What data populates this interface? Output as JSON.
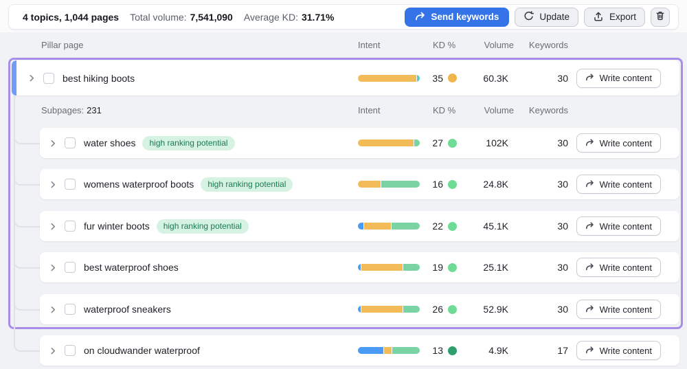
{
  "topbar": {
    "summary": {
      "topics_pages": "4 topics, 1,044 pages",
      "total_volume_label": "Total volume:",
      "total_volume_value": "7,541,090",
      "average_kd_label": "Average KD:",
      "average_kd_value": "31.71%"
    },
    "buttons": {
      "send_keywords": "Send keywords",
      "update": "Update",
      "export": "Export"
    }
  },
  "table": {
    "header": {
      "pillar_page": "Pillar page",
      "intent": "Intent",
      "kd": "KD %",
      "volume": "Volume",
      "keywords": "Keywords"
    },
    "subpages": {
      "label": "Subpages:",
      "count": "231"
    },
    "subheader": {
      "intent": "Intent",
      "kd": "KD %",
      "volume": "Volume",
      "keywords": "Keywords"
    },
    "write_content_label": "Write content",
    "pillar_row": {
      "name": "best hiking boots",
      "intent_segments": [
        {
          "color": "yellow",
          "pct": 95
        },
        {
          "color": "teal",
          "pct": 5
        }
      ],
      "kd": "35",
      "kd_level": "medium",
      "volume": "60.3K",
      "keywords": "30"
    },
    "rows": [
      {
        "name": "water shoes",
        "badge": "high ranking potential",
        "intent_segments": [
          {
            "color": "yellow",
            "pct": 91
          },
          {
            "color": "green",
            "pct": 9
          }
        ],
        "kd": "27",
        "kd_level": "easy",
        "volume": "102K",
        "keywords": "30"
      },
      {
        "name": "womens waterproof boots",
        "badge": "high ranking potential",
        "intent_segments": [
          {
            "color": "yellow",
            "pct": 37
          },
          {
            "color": "green",
            "pct": 63
          }
        ],
        "kd": "16",
        "kd_level": "easy",
        "volume": "24.8K",
        "keywords": "30"
      },
      {
        "name": "fur winter boots",
        "badge": "high ranking potential",
        "intent_segments": [
          {
            "color": "blue",
            "pct": 9
          },
          {
            "color": "yellow",
            "pct": 44
          },
          {
            "color": "green",
            "pct": 47
          }
        ],
        "kd": "22",
        "kd_level": "easy",
        "volume": "45.1K",
        "keywords": "30"
      },
      {
        "name": "best waterproof shoes",
        "badge": null,
        "intent_segments": [
          {
            "color": "blue",
            "pct": 5
          },
          {
            "color": "yellow",
            "pct": 68
          },
          {
            "color": "green",
            "pct": 27
          }
        ],
        "kd": "19",
        "kd_level": "easy",
        "volume": "25.1K",
        "keywords": "30"
      },
      {
        "name": "waterproof sneakers",
        "badge": null,
        "intent_segments": [
          {
            "color": "blue",
            "pct": 4
          },
          {
            "color": "yellow",
            "pct": 69
          },
          {
            "color": "green",
            "pct": 27
          }
        ],
        "kd": "26",
        "kd_level": "easy",
        "volume": "52.9K",
        "keywords": "30"
      },
      {
        "name": "on cloudwander waterproof",
        "badge": null,
        "intent_segments": [
          {
            "color": "blue",
            "pct": 42
          },
          {
            "color": "yellow",
            "pct": 12
          },
          {
            "color": "green",
            "pct": 46
          }
        ],
        "kd": "13",
        "kd_level": "very_easy",
        "volume": "4.9K",
        "keywords": "17"
      }
    ]
  },
  "colors": {
    "accent_blue": "#3574e8",
    "selection_purple": "#a88dea",
    "row_indicator_blue": "#6f9df6",
    "badge_bg": "#d6f2e3",
    "badge_text": "#197a4e",
    "intent": {
      "blue": "#4a9bf5",
      "yellow": "#f2bb57",
      "green": "#7ad3a2",
      "teal": "#53cfc0"
    },
    "kd": {
      "medium": "#f0b64e",
      "easy": "#6edc95",
      "very_easy": "#2f9e6d"
    }
  }
}
